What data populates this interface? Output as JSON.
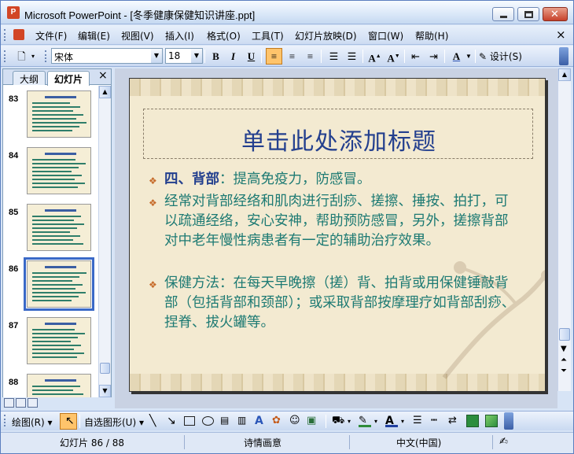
{
  "window": {
    "title": "Microsoft PowerPoint - [冬季健康保健知识讲座.ppt]",
    "app_icon_letter": "P"
  },
  "menu": {
    "items": [
      "文件(F)",
      "编辑(E)",
      "视图(V)",
      "插入(I)",
      "格式(O)",
      "工具(T)",
      "幻灯片放映(D)",
      "窗口(W)",
      "帮助(H)"
    ],
    "close_glyph": "×"
  },
  "toolbar": {
    "font_name": "宋体",
    "font_size": "18",
    "bold": "B",
    "italic": "I",
    "underline": "U",
    "design_label": "设计(S)"
  },
  "left_panel": {
    "tabs": [
      "大纲",
      "幻灯片"
    ],
    "active_tab": "幻灯片",
    "close_glyph": "×",
    "thumbnails": [
      {
        "number": "83"
      },
      {
        "number": "84"
      },
      {
        "number": "85"
      },
      {
        "number": "86",
        "selected": true
      },
      {
        "number": "87"
      },
      {
        "number": "88"
      }
    ]
  },
  "slide": {
    "title": "单击此处添加标题",
    "bullets": [
      {
        "head": "四、背部",
        "text": "：提高免疫力，防感冒。"
      },
      {
        "head": "",
        "text": "经常对背部经络和肌肉进行刮痧、搓擦、捶按、拍打，可以疏通经络，安心安神，帮助预防感冒，另外，搓擦背部对中老年慢性病患者有一定的辅助治疗效果。"
      },
      {
        "head": "",
        "text": "保健方法：在每天早晚擦（搓）背、拍背或用保健锤敲背部（包括背部和颈部）；或采取背部按摩理疗如背部刮痧、捏脊、拔火罐等。"
      }
    ],
    "bullet_glyph": "❖",
    "colors": {
      "title": "#233f8e",
      "body": "#1d7a73",
      "bullet": "#c66b2a",
      "background": "#f3ead1"
    }
  },
  "drawing_toolbar": {
    "draw_label": "绘图(R)",
    "autoshapes_label": "自选图形(U)"
  },
  "status": {
    "slide_pos": "幻灯片 86 / 88",
    "design": "诗情画意",
    "language": "中文(中国)"
  }
}
